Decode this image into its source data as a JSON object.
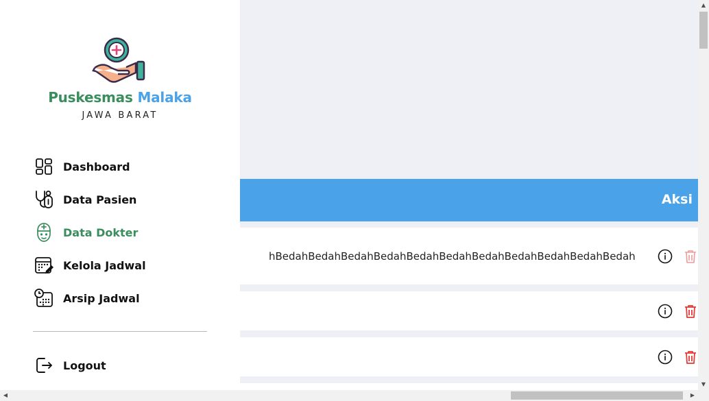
{
  "brand": {
    "name_part1": "Puskesmas",
    "name_part2": "Malaka",
    "region": "JAWA BARAT"
  },
  "sidebar": {
    "items": [
      {
        "label": "Dashboard",
        "icon": "dashboard-icon"
      },
      {
        "label": "Data Pasien",
        "icon": "stethoscope-icon"
      },
      {
        "label": "Data Dokter",
        "icon": "doctor-icon",
        "active": true
      },
      {
        "label": "Kelola Jadwal",
        "icon": "calendar-edit-icon"
      },
      {
        "label": "Arsip Jadwal",
        "icon": "calendar-clock-icon"
      }
    ],
    "logout_label": "Logout"
  },
  "table": {
    "header_action": "Aksi",
    "rows": [
      {
        "text": "hBedahBedahBedahBedahBedahBedahBedahBedahBedahBedahBedah"
      },
      {
        "text": ""
      },
      {
        "text": ""
      }
    ]
  },
  "colors": {
    "accent": "#4aa3e8",
    "brand_green": "#3a8d5c",
    "danger": "#e53935"
  }
}
